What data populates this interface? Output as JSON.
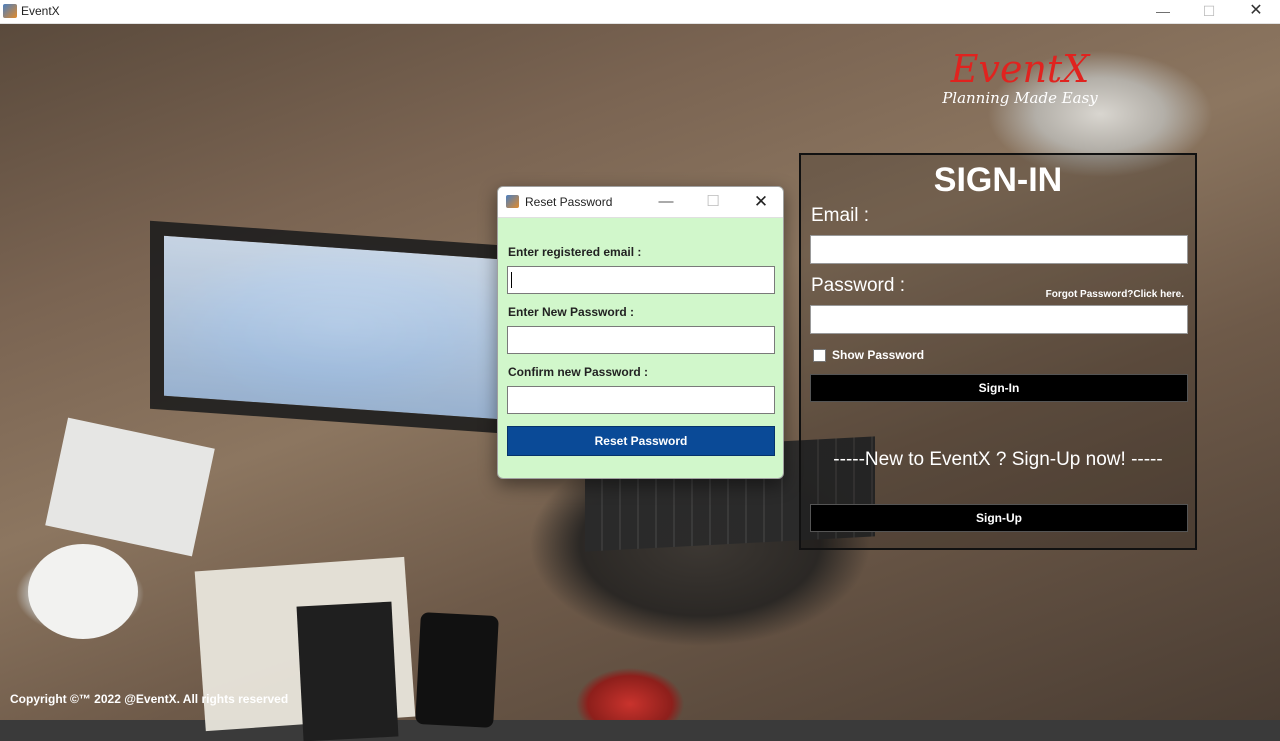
{
  "window": {
    "title": "EventX",
    "controls": {
      "minimize": "—",
      "maximize": "☐",
      "close": "✕"
    }
  },
  "brand": {
    "logo": "EventX",
    "tagline": "Planning Made Easy"
  },
  "signin": {
    "heading": "SIGN-IN",
    "email_label": "Email :",
    "email_value": "",
    "password_label": "Password :",
    "password_value": "",
    "forgot_link": "Forgot Password?Click here.",
    "show_password_label": "Show Password",
    "show_password_checked": false,
    "signin_button": "Sign-In",
    "new_user_text": "-----New to EventX ? Sign-Up now! -----",
    "signup_button": "Sign-Up"
  },
  "copyright": "Copyright ©™ 2022 @EventX. All rights reserved",
  "dialog": {
    "title": "Reset Password",
    "controls": {
      "minimize": "—",
      "maximize": "☐",
      "close": "✕"
    },
    "email_label": "Enter registered email :",
    "email_value": "",
    "new_password_label": "Enter New Password :",
    "new_password_value": "",
    "confirm_password_label": "Confirm new Password :",
    "confirm_password_value": "",
    "reset_button": "Reset Password",
    "background_color": "#d1f7cb",
    "button_color": "#0a4a97"
  },
  "colors": {
    "logo": "#e0231f",
    "signin_button": "#000000"
  }
}
